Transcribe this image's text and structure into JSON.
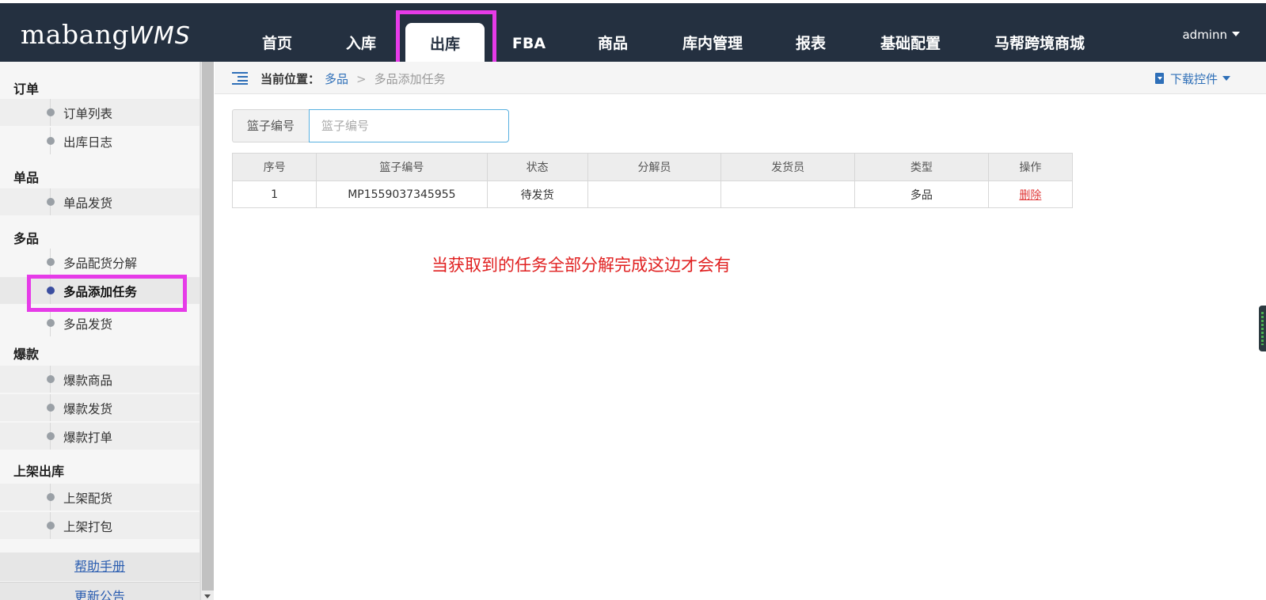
{
  "header": {
    "logo_main": "mabang",
    "logo_accent": "WMS",
    "nav": [
      {
        "label": "首页"
      },
      {
        "label": "入库"
      },
      {
        "label": "出库"
      },
      {
        "label": "FBA"
      },
      {
        "label": "商品"
      },
      {
        "label": "库内管理"
      },
      {
        "label": "报表"
      },
      {
        "label": "基础配置"
      },
      {
        "label": "马帮跨境商城"
      }
    ],
    "active_tab": "出库",
    "user": "adminn"
  },
  "sidebar": {
    "sections": [
      {
        "title": "订单",
        "items": [
          "订单列表",
          "出库日志"
        ]
      },
      {
        "title": "单品",
        "items": [
          "单品发货"
        ]
      },
      {
        "title": "多品",
        "items": [
          "多品配货分解",
          "多品添加任务",
          "多品发货"
        ]
      },
      {
        "title": "爆款",
        "items": [
          "爆款商品",
          "爆款发货",
          "爆款打单"
        ]
      },
      {
        "title": "上架出库",
        "items": [
          "上架配货",
          "上架打包"
        ]
      }
    ],
    "active_item": "多品添加任务",
    "footer_links": [
      "帮助手册",
      "更新公告"
    ]
  },
  "breadcrumb": {
    "prefix": "当前位置：",
    "parent": "多品",
    "separator": ">",
    "current": "多品添加任务"
  },
  "toolbar": {
    "download": "下载控件"
  },
  "search": {
    "label": "篮子编号",
    "placeholder": "篮子编号",
    "value": ""
  },
  "table": {
    "columns": [
      "序号",
      "篮子编号",
      "状态",
      "分解员",
      "发货员",
      "类型",
      "操作"
    ],
    "rows": [
      {
        "index": "1",
        "basket": "MP1559037345955",
        "status": "待发货",
        "splitter": "",
        "shipper": "",
        "type": "多品",
        "action": "删除"
      }
    ]
  },
  "annotation": "当获取到的任务全部分解完成这边才会有",
  "colors": {
    "header_bg": "#243040",
    "highlight": "#e63be8",
    "link": "#2e6fb8",
    "delete": "#e03c3c",
    "annotation": "#e02020"
  }
}
